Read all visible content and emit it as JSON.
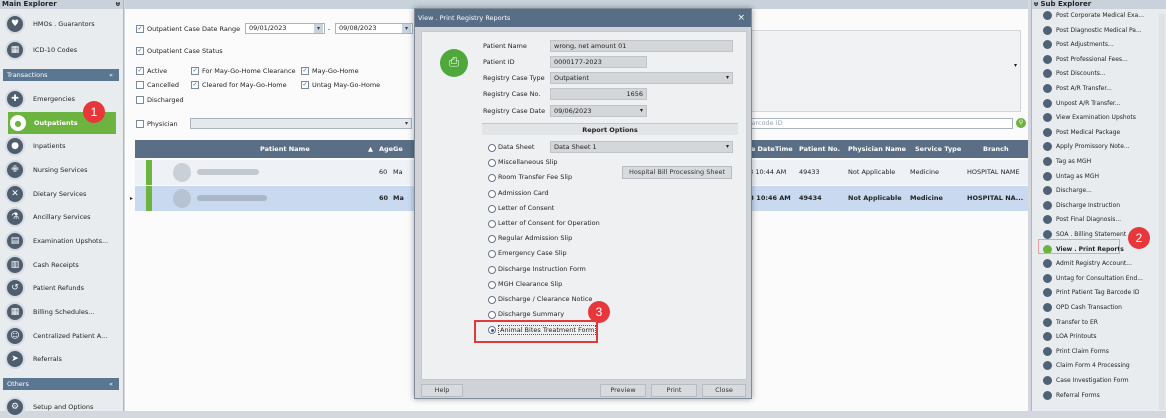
{
  "left": {
    "title": "Main Explorer",
    "top_items": [
      {
        "label": "HMOs . Guarantors",
        "icon": "heart-icon"
      },
      {
        "label": "ICD-10 Codes",
        "icon": "code-icon"
      }
    ],
    "transactions_label": "Transactions",
    "items": [
      {
        "label": "Emergencies",
        "icon": "plus-icon"
      },
      {
        "label": "Outpatients",
        "icon": "person-icon"
      },
      {
        "label": "Inpatients",
        "icon": "person-icon"
      },
      {
        "label": "Nursing Services",
        "icon": "nurse-icon"
      },
      {
        "label": "Dietary Services",
        "icon": "utensils-icon"
      },
      {
        "label": "Ancillary Services",
        "icon": "flask-icon"
      },
      {
        "label": "Examination Upshots...",
        "icon": "chart-icon"
      },
      {
        "label": "Cash Receipts",
        "icon": "receipt-icon"
      },
      {
        "label": "Patient Refunds",
        "icon": "refund-icon"
      },
      {
        "label": "Billing Schedules...",
        "icon": "calendar-icon"
      },
      {
        "label": "Centralized Patient A...",
        "icon": "user-icon"
      },
      {
        "label": "Referrals",
        "icon": "referral-icon"
      }
    ],
    "others_label": "Others",
    "setup_label": "Setup and Options",
    "pin": "ᵾ",
    "collapse": "«"
  },
  "filters": {
    "date_range_label": "Outpatient Case Date Range",
    "date_from": "09/01/2023",
    "date_to": "09/08/2023",
    "status_label": "Outpatient Case Status",
    "active": "Active",
    "cancelled": "Cancelled",
    "discharged": "Discharged",
    "for_mgh": "For May-Go-Home Clearance",
    "cleared_mgh": "Cleared for May-Go-Home",
    "may_go_home": "May-Go-Home",
    "untag_mgh": "Untag May-Go-Home",
    "physician_label": "Physician",
    "barcode_placeholder": "Barcode ID"
  },
  "grid": {
    "headers": [
      "Patient Name",
      "Age",
      "Ge",
      "se DateTime",
      "Patient No.",
      "Physician Name",
      "Service Type",
      "Branch"
    ],
    "rows": [
      {
        "age": "60",
        "gender": "Ma",
        "datetime": "23 10:44 AM",
        "patient_no": "49433",
        "physician": "Not Applicable",
        "service": "Medicine",
        "branch": "HOSPITAL NAME"
      },
      {
        "age": "60",
        "gender": "Ma",
        "datetime": "23 10:46 AM",
        "patient_no": "49434",
        "physician": "Not Applicable",
        "service": "Medicine",
        "branch": "HOSPITAL NA..."
      }
    ]
  },
  "dialog": {
    "title": "View . Print Registry Reports",
    "close": "×",
    "patient_name_label": "Patient Name",
    "patient_name": "wrong, net amount 01",
    "patient_id_label": "Patient ID",
    "patient_id": "0000177-2023",
    "case_type_label": "Registry Case Type",
    "case_type": "Outpatient",
    "case_no_label": "Registry Case No.",
    "case_no": "1656",
    "case_date_label": "Registry Case Date",
    "case_date": "09/06/2023",
    "report_options_label": "Report Options",
    "data_sheet_value": "Data Sheet 1",
    "hospital_bill_button": "Hospital Bill Processing Sheet",
    "options": [
      "Data Sheet",
      "Miscellaneous Slip",
      "Room Transfer Fee Slip",
      "Admission Card",
      "Letter of Consent",
      "Letter of Consent for Operation",
      "Regular Admission Slip",
      "Emergency Case Slip",
      "Discharge Instruction Form",
      "MGH Clearance Slip",
      "Discharge / Clearance  Notice",
      "Discharge Summary",
      "Animal Bites Treatment Form"
    ],
    "selected_option": "Animal Bites Treatment Form",
    "help": "Help",
    "preview": "Preview",
    "print": "Print",
    "close_button": "Close"
  },
  "right": {
    "title": "Sub Explorer",
    "items": [
      "Post Corporate Medical Exa...",
      "Post Diagnostic Medical Pa...",
      "Post Adjustments...",
      "Post Professional Fees...",
      "Post Discounts...",
      "Post A/R Transfer...",
      "Unpost A/R Transfer...",
      "View Examination Upshots",
      "Post Medical Package",
      "Apply Promissory Note...",
      "Tag as MGH",
      "Untag as MGH",
      "Discharge...",
      "Discharge Instruction",
      "Post Final Diagnosis...",
      "SOA . Billing Statement",
      "View . Print Reports",
      "Admit Registry Account...",
      "Untag for Consultation End...",
      "Print Patient Tag Barcode ID",
      "OPD Cash Transaction",
      "Transfer to ER",
      "LOA Printouts",
      "Print Claim Forms",
      "Claim Form 4 Processing",
      "Case Investigation Form",
      "Referral Forms"
    ],
    "highlighted": "View . Print Reports"
  },
  "annotations": [
    "1",
    "2",
    "3"
  ],
  "colors": {
    "accent_green": "#6db33f",
    "header_blue": "#586e86",
    "badge_red": "#e8373a"
  }
}
